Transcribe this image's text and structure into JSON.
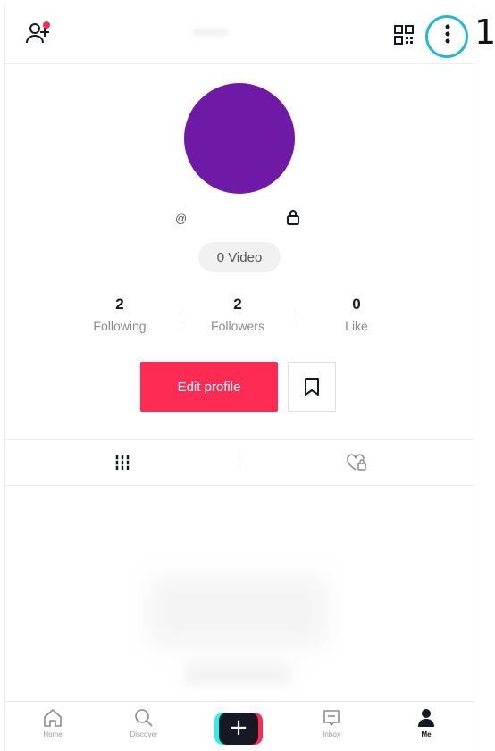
{
  "annotation": {
    "number": "1",
    "color": "#29b7cf"
  },
  "profile": {
    "handle_prefix": "@",
    "avatar_color": "#6f1aa6",
    "video_count_label": "0 Video"
  },
  "stats": [
    {
      "value": "2",
      "label": "Following"
    },
    {
      "value": "2",
      "label": "Followers"
    },
    {
      "value": "0",
      "label": "Like"
    }
  ],
  "actions": {
    "edit_profile_label": "Edit profile",
    "accent_color": "#fe2c55"
  },
  "tabs": [
    {
      "icon": "grid-icon"
    },
    {
      "icon": "liked-lock-icon"
    }
  ],
  "bottom_nav": {
    "items": [
      {
        "label": "Home",
        "icon": "home-icon"
      },
      {
        "label": "Discover",
        "icon": "search-icon"
      },
      {
        "label": "+",
        "icon": "create-icon"
      },
      {
        "label": "Inbox",
        "icon": "inbox-icon"
      },
      {
        "label": "Me",
        "icon": "profile-icon"
      }
    ]
  },
  "header_icons": [
    "add-user-icon",
    "qr-code-icon",
    "more-options-icon"
  ]
}
